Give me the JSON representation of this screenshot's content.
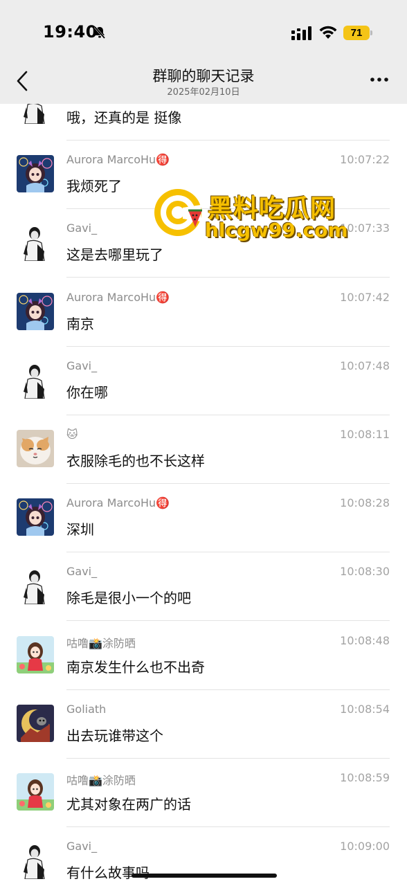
{
  "status_bar": {
    "time": "19:40",
    "battery_level": "71",
    "icons": [
      "bell-slash-icon",
      "signal-icon",
      "wifi-icon",
      "battery-icon"
    ]
  },
  "nav": {
    "title": "群聊的聊天记录",
    "subtitle": "2025年02月10日",
    "back_icon": "chevron-left-icon",
    "more_icon": "more-dots-icon"
  },
  "messages": [
    {
      "sender": "",
      "time": "",
      "text": "哦，还真的是 挺像",
      "avatar": "gavi"
    },
    {
      "sender": "Aurora MarcoHu🉐",
      "time": "10:07:22",
      "text": "我烦死了",
      "avatar": "aurora"
    },
    {
      "sender": "Gavi_",
      "time": "10:07:33",
      "text": "这是去哪里玩了",
      "avatar": "gavi"
    },
    {
      "sender": "Aurora MarcoHu🉐",
      "time": "10:07:42",
      "text": "南京",
      "avatar": "aurora"
    },
    {
      "sender": "Gavi_",
      "time": "10:07:48",
      "text": "你在哪",
      "avatar": "gavi"
    },
    {
      "sender": "🐱",
      "time": "10:08:11",
      "text": "衣服除毛的也不长这样",
      "avatar": "cat"
    },
    {
      "sender": "Aurora MarcoHu🉐",
      "time": "10:08:28",
      "text": "深圳",
      "avatar": "aurora"
    },
    {
      "sender": "Gavi_",
      "time": "10:08:30",
      "text": "除毛是很小一个的吧",
      "avatar": "gavi"
    },
    {
      "sender": "咕噜📸涂防晒",
      "time": "10:08:48",
      "text": "南京发生什么也不出奇",
      "avatar": "gulu"
    },
    {
      "sender": "Goliath",
      "time": "10:08:54",
      "text": "出去玩谁带这个",
      "avatar": "goliath"
    },
    {
      "sender": "咕噜📸涂防晒",
      "time": "10:08:59",
      "text": "尤其对象在两广的话",
      "avatar": "gulu"
    },
    {
      "sender": "Gavi_",
      "time": "10:09:00",
      "text": "有什么故事吗",
      "avatar": "gavi"
    }
  ],
  "watermark": {
    "title": "黑料吃瓜网",
    "url": "hlcgw99.com"
  },
  "colors": {
    "topbar_bg": "#ededed",
    "name_gray": "#8c8c8c",
    "divider": "#e3e3e3",
    "battery_yellow": "#f4c417",
    "watermark_yellow": "#f6c000"
  }
}
